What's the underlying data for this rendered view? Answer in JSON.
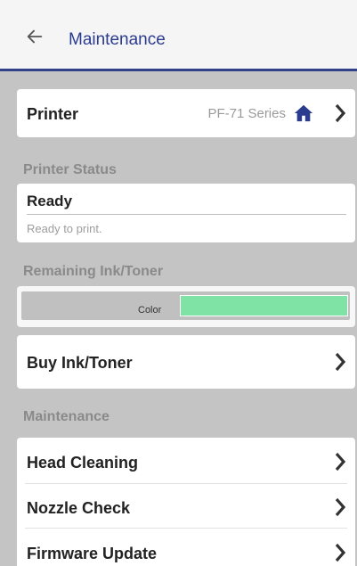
{
  "header": {
    "title": "Maintenance",
    "back_icon": "arrow-left-icon",
    "accent_color": "#30418a"
  },
  "printer": {
    "label": "Printer",
    "value": "PF-71 Series",
    "home_icon": "home-icon",
    "home_icon_color": "#2b3c8f"
  },
  "printer_status": {
    "section_label": "Printer Status",
    "status": "Ready",
    "description": "Ready to print."
  },
  "ink": {
    "section_label": "Remaining Ink/Toner",
    "items": [
      {
        "label": "Color",
        "color": "#7ee3a5"
      }
    ]
  },
  "buy": {
    "label": "Buy Ink/Toner"
  },
  "maintenance": {
    "section_label": "Maintenance",
    "items": [
      {
        "label": "Head Cleaning"
      },
      {
        "label": "Nozzle Check"
      },
      {
        "label": "Firmware Update"
      }
    ]
  },
  "chevron_icon": "chevron-right-icon"
}
